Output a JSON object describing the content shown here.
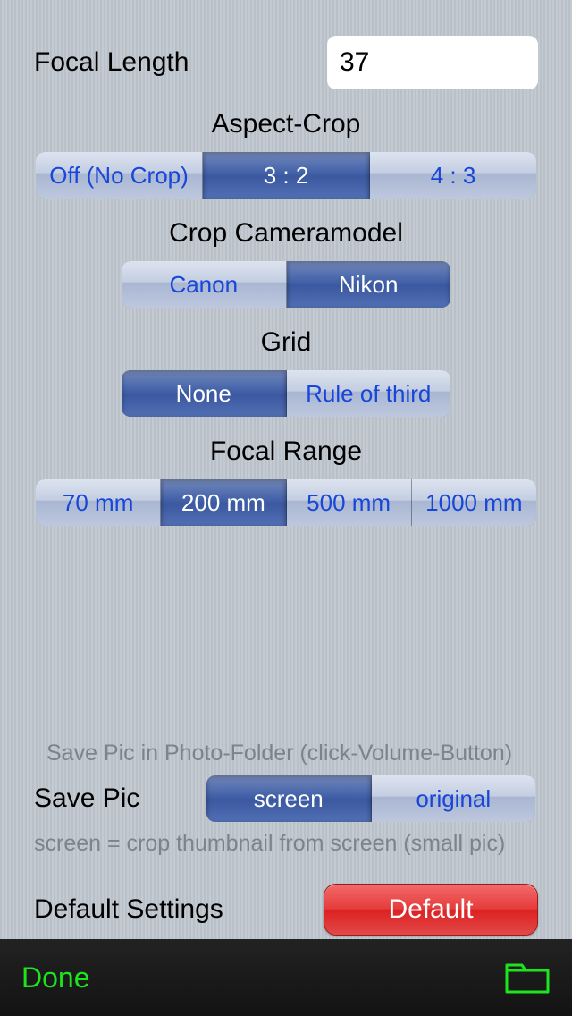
{
  "focal_length": {
    "label": "Focal Length",
    "value": "37"
  },
  "aspect_crop": {
    "title": "Aspect-Crop",
    "options": [
      "Off (No Crop)",
      "3 : 2",
      "4 : 3"
    ],
    "selected": 1
  },
  "camera_model": {
    "title": "Crop Cameramodel",
    "options": [
      "Canon",
      "Nikon"
    ],
    "selected": 1
  },
  "grid": {
    "title": "Grid",
    "options": [
      "None",
      "Rule of third"
    ],
    "selected": 0
  },
  "focal_range": {
    "title": "Focal Range",
    "options": [
      "70 mm",
      "200 mm",
      "500 mm",
      "1000 mm"
    ],
    "selected": 1
  },
  "save_hint_top": "Save Pic in Photo-Folder (click-Volume-Button)",
  "save_pic": {
    "label": "Save Pic",
    "options": [
      "screen",
      "original"
    ],
    "selected": 0
  },
  "save_hint_bottom": "screen = crop thumbnail from screen (small pic)",
  "default_settings": {
    "label": "Default Settings",
    "button": "Default"
  },
  "toolbar": {
    "done": "Done"
  }
}
